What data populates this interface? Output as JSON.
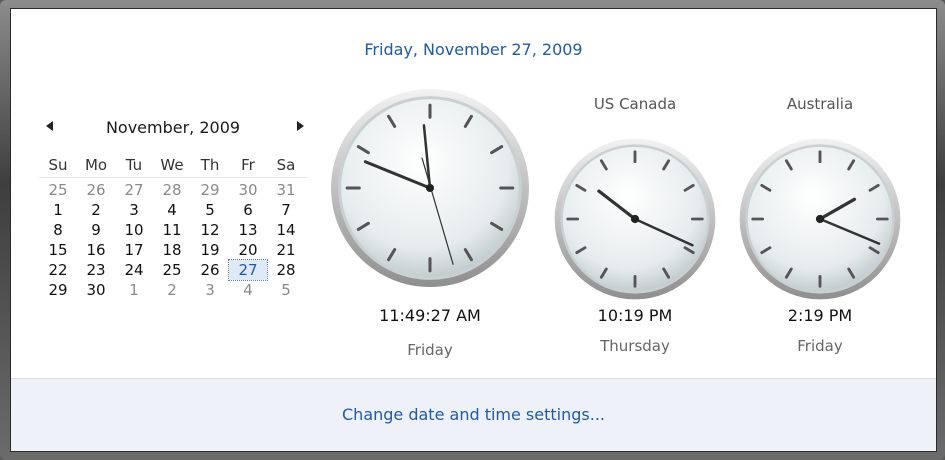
{
  "header": {
    "date_text": "Friday, November 27, 2009"
  },
  "calendar": {
    "month_title": "November, 2009",
    "weekdays": [
      "Su",
      "Mo",
      "Tu",
      "We",
      "Th",
      "Fr",
      "Sa"
    ],
    "weeks": [
      [
        "25",
        "26",
        "27",
        "28",
        "29",
        "30",
        "31"
      ],
      [
        "1",
        "2",
        "3",
        "4",
        "5",
        "6",
        "7"
      ],
      [
        "8",
        "9",
        "10",
        "11",
        "12",
        "13",
        "14"
      ],
      [
        "15",
        "16",
        "17",
        "18",
        "19",
        "20",
        "21"
      ],
      [
        "22",
        "23",
        "24",
        "25",
        "26",
        "27",
        "28"
      ],
      [
        "29",
        "30",
        "1",
        "2",
        "3",
        "4",
        "5"
      ]
    ],
    "selected_day": "27"
  },
  "clocks": [
    {
      "city": "",
      "time": "11:49:27 AM",
      "day": "Friday"
    },
    {
      "city": "US Canada",
      "time": "10:19 PM",
      "day": "Thursday"
    },
    {
      "city": "Australia",
      "time": "2:19 PM",
      "day": "Friday"
    }
  ],
  "footer": {
    "link_text": "Change date and time settings..."
  },
  "colors": {
    "link": "#1e5aa8",
    "footer_bg": "#eef2f8",
    "today_bg": "#dfeaf8"
  },
  "icons": {
    "prev": "triangle-left-icon",
    "next": "triangle-right-icon"
  }
}
